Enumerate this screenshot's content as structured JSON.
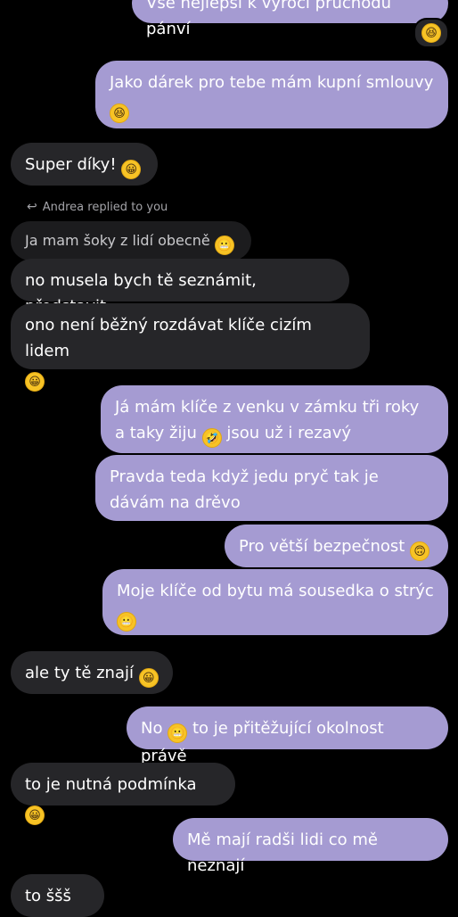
{
  "messages": [
    {
      "id": "m0",
      "text": "Vše nejlepší k výročí průchodu pánví",
      "dir": "out"
    },
    {
      "id": "m1",
      "text": "Jako dárek pro tebe mám kupní smlouvy",
      "dir": "out",
      "emoji": "😆"
    },
    {
      "id": "m2",
      "text": "Super díky!",
      "dir": "in",
      "emoji": "😀"
    },
    {
      "id": "m3",
      "text": "Ja mam šoky z lidí obecně",
      "dir": "in",
      "emoji": "😬"
    },
    {
      "id": "m4",
      "text": "no musela bych tě seznámit, představit",
      "dir": "in"
    },
    {
      "id": "m5",
      "text": "ono není běžný rozdávat klíče cizím lidem",
      "dir": "in",
      "emoji": "😀"
    },
    {
      "id": "m6",
      "text": "Já mám klíče z venku v zámku tři roky a taky žiju",
      "emoji": "🤣",
      "text_after": "jsou už i rezavý",
      "dir": "out"
    },
    {
      "id": "m7",
      "text": "Pravda teda když jedu pryč tak je dávám na drěvo",
      "dir": "out"
    },
    {
      "id": "m8",
      "text": "Pro větší bezpečnost",
      "dir": "out",
      "emoji": "🙃"
    },
    {
      "id": "m9",
      "text": "Moje klíče od bytu má sousedka o strýc",
      "dir": "out",
      "emoji": "😬"
    },
    {
      "id": "m10",
      "text": "ale ty tě znají",
      "dir": "in",
      "emoji": "😀"
    },
    {
      "id": "m11",
      "text_before": "No",
      "emoji": "😬",
      "text": "to je přitěžující okolnost právě",
      "dir": "out"
    },
    {
      "id": "m12",
      "text": "to je nutná podmínka",
      "dir": "in",
      "emoji": "😀"
    },
    {
      "id": "m13",
      "text": "Mě mají radši lidi co mě neznají",
      "dir": "out"
    },
    {
      "id": "m14",
      "text": "to ššš",
      "dir": "in"
    }
  ],
  "reply_label": "Andrea replied to you",
  "reaction_emoji": "😆"
}
